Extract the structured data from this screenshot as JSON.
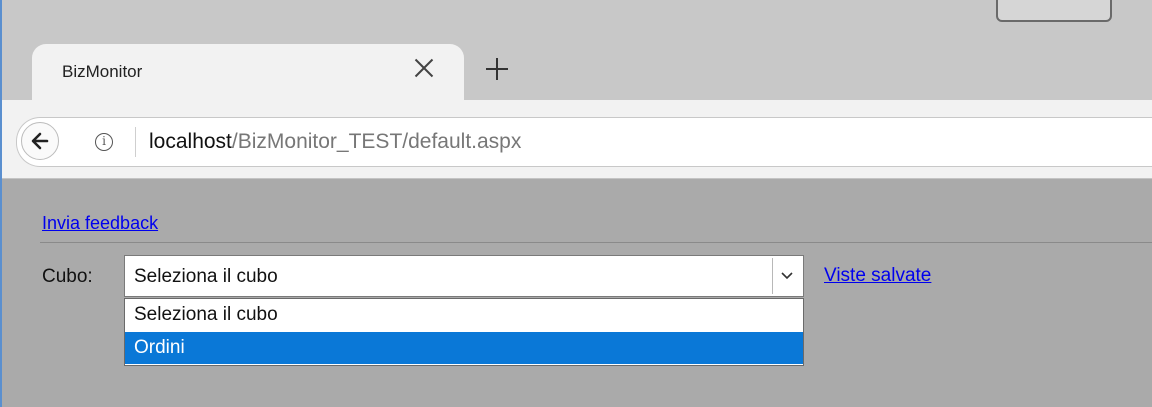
{
  "browser": {
    "tab_title": "BizMonitor",
    "url_host": "localhost",
    "url_path": "/BizMonitor_TEST/default.aspx",
    "icons": {
      "back": "back-arrow-icon",
      "info": "info-icon",
      "close_tab": "close-icon",
      "new_tab": "plus-icon"
    },
    "info_glyph": "i"
  },
  "page": {
    "feedback_link": "Invia feedback",
    "cubo_label": "Cubo:",
    "select_value": "Seleziona il cubo",
    "saved_views_link": "Viste salvate",
    "options": [
      "Seleziona il cubo",
      "Ordini"
    ],
    "highlighted_option": "Ordini",
    "colors": {
      "link": "#0000ee",
      "highlight": "#0a78d7",
      "page_bg": "#aaaaaa"
    }
  }
}
